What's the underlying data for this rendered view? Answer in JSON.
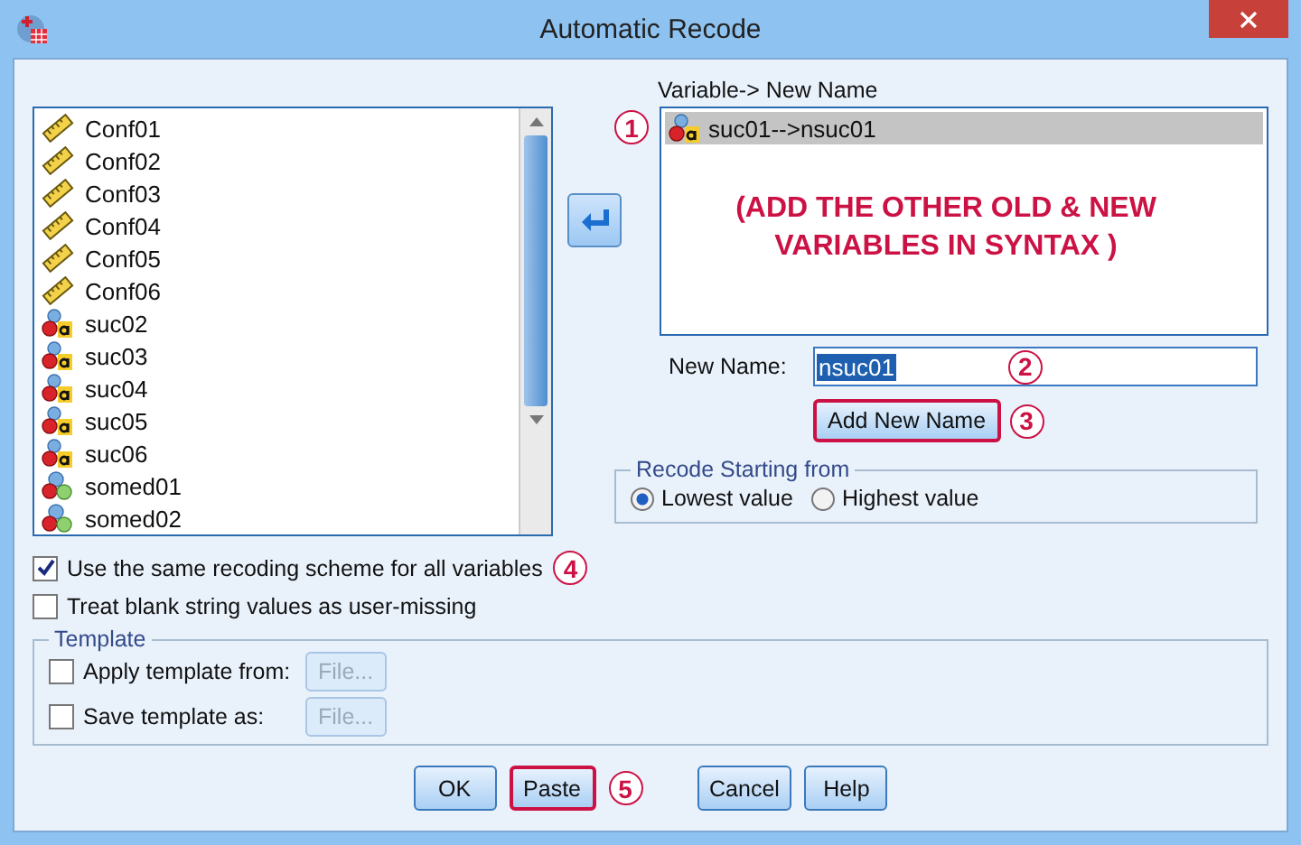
{
  "window": {
    "title": "Automatic Recode"
  },
  "source_variables": [
    {
      "name": "Conf01",
      "kind": "scale"
    },
    {
      "name": "Conf02",
      "kind": "scale"
    },
    {
      "name": "Conf03",
      "kind": "scale"
    },
    {
      "name": "Conf04",
      "kind": "scale"
    },
    {
      "name": "Conf05",
      "kind": "scale"
    },
    {
      "name": "Conf06",
      "kind": "scale"
    },
    {
      "name": "suc02",
      "kind": "string"
    },
    {
      "name": "suc03",
      "kind": "string"
    },
    {
      "name": "suc04",
      "kind": "string"
    },
    {
      "name": "suc05",
      "kind": "string"
    },
    {
      "name": "suc06",
      "kind": "string"
    },
    {
      "name": "somed01",
      "kind": "nominal"
    },
    {
      "name": "somed02",
      "kind": "nominal"
    }
  ],
  "target_list": {
    "label": "Variable-> New Name",
    "items": [
      {
        "text": "suc01-->nsuc01",
        "kind": "string",
        "selected": true
      }
    ],
    "note": "(ADD THE OTHER OLD & NEW VARIABLES IN SYNTAX )"
  },
  "new_name": {
    "label": "New Name:",
    "value": "nsuc01"
  },
  "add_button": "Add New Name",
  "recode_start": {
    "title": "Recode Starting from",
    "options": [
      {
        "label": "Lowest value",
        "selected": true
      },
      {
        "label": "Highest value",
        "selected": false
      }
    ]
  },
  "options": [
    {
      "label": "Use the same recoding scheme for all variables",
      "checked": true
    },
    {
      "label": "Treat blank string values as user-missing",
      "checked": false
    }
  ],
  "template": {
    "title": "Template",
    "rows": [
      {
        "label": "Apply template from:",
        "checked": false,
        "button": "File...",
        "disabled": true
      },
      {
        "label": "Save template as:",
        "checked": false,
        "button": "File...",
        "disabled": true
      }
    ]
  },
  "buttons": [
    {
      "label": "OK",
      "highlighted": false
    },
    {
      "label": "Paste",
      "highlighted": true
    },
    {
      "label": "Cancel",
      "highlighted": false
    },
    {
      "label": "Help",
      "highlighted": false
    }
  ],
  "callouts": [
    "1",
    "2",
    "3",
    "4",
    "5"
  ]
}
